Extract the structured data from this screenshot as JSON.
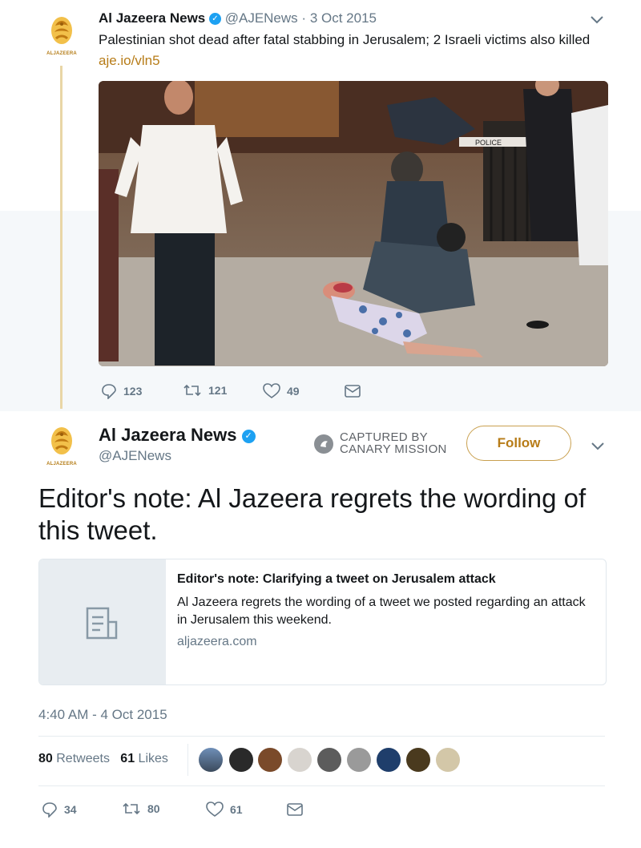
{
  "original_tweet": {
    "author_name": "Al Jazeera News",
    "handle": "@AJENews",
    "separator": "·",
    "date": "3 Oct 2015",
    "text": "Palestinian shot dead after fatal stabbing in Jerusalem; 2 Israeli victims also killed",
    "link": "aje.io/vln5",
    "logo_caption": "ALJAZEERA",
    "replies": "123",
    "retweets": "121",
    "likes": "49",
    "photo_sign": "POLICE"
  },
  "main_tweet": {
    "author_name": "Al Jazeera News",
    "handle": "@AJENews",
    "logo_caption": "ALJAZEERA",
    "watermark_line1": "CAPTURED BY",
    "watermark_line2": "CANARY MISSION",
    "follow_label": "Follow",
    "text": "Editor's note: Al Jazeera regrets the wording of this tweet.",
    "card": {
      "title": "Editor's note: Clarifying a tweet on Jerusalem attack",
      "description": "Al Jazeera regrets the wording of a tweet we posted regarding an attack in Jerusalem this weekend.",
      "domain": "aljazeera.com"
    },
    "timestamp": "4:40 AM - 4 Oct 2015",
    "stats": {
      "retweets_count": "80",
      "retweets_label": "Retweets",
      "likes_count": "61",
      "likes_label": "Likes"
    },
    "actions": {
      "replies": "34",
      "retweets": "80",
      "likes": "61"
    }
  },
  "colors": {
    "brand_gold": "#b77c18",
    "verified_blue": "#1da1f2",
    "muted": "#657786"
  },
  "icons": [
    "aljazeera-logo-icon",
    "verified-icon",
    "chevron-down-icon",
    "reply-icon",
    "retweet-icon",
    "like-icon",
    "dm-icon",
    "article-icon",
    "canary-mission-icon"
  ]
}
